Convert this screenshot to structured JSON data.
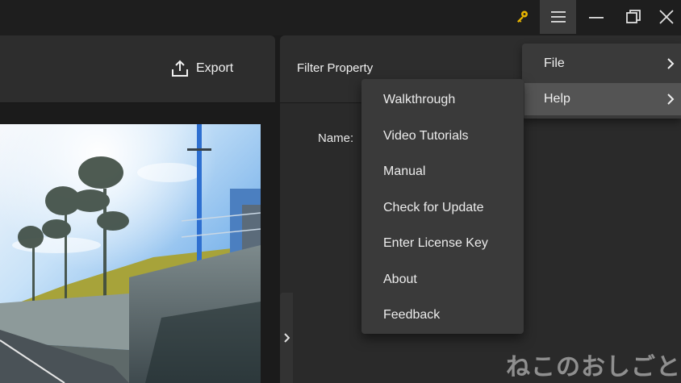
{
  "header": {
    "export_label": "Export"
  },
  "panel": {
    "filter_title": "Filter Property",
    "name_label": "Name:"
  },
  "menu": {
    "items": [
      {
        "label": "File"
      },
      {
        "label": "Help"
      }
    ],
    "help_submenu": [
      {
        "label": "Walkthrough"
      },
      {
        "label": "Video Tutorials"
      },
      {
        "label": "Manual"
      },
      {
        "label": "Check for Update"
      },
      {
        "label": "Enter License Key"
      },
      {
        "label": "About"
      },
      {
        "label": "Feedback"
      }
    ]
  },
  "watermark": {
    "text": "ねこのおしごと"
  },
  "icons": {
    "key": "key-icon",
    "menu": "hamburger-menu-icon",
    "minimize": "minimize-icon",
    "maximize": "maximize-icon",
    "close": "close-icon",
    "export": "export-icon",
    "chevron": "chevron-right-icon"
  },
  "colors": {
    "key_icon": "#e8b400",
    "menu_bg": "#3a3a3a",
    "menu_highlight": "#545454"
  }
}
